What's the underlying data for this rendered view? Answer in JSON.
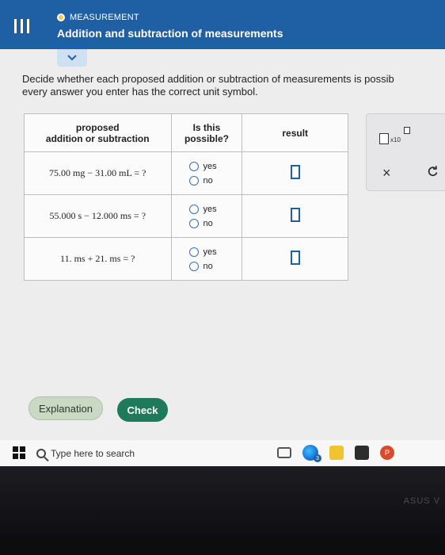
{
  "header": {
    "kicker": "MEASUREMENT",
    "title": "Addition and subtraction of measurements"
  },
  "instructions": {
    "line1": "Decide whether each proposed addition or subtraction of measurements is possib",
    "line2": "every answer you enter has the correct unit symbol."
  },
  "table": {
    "headers": {
      "col1_line1": "proposed",
      "col1_line2": "addition or subtraction",
      "col2_line1": "Is this",
      "col2_line2": "possible?",
      "col3": "result"
    },
    "rows": [
      {
        "expression": "75.00 mg − 31.00 mL = ?",
        "yes": "yes",
        "no": "no"
      },
      {
        "expression": "55.000 s − 12.000 ms = ?",
        "yes": "yes",
        "no": "no"
      },
      {
        "expression": "11. ms + 21. ms = ?",
        "yes": "yes",
        "no": "no"
      }
    ]
  },
  "tools": {
    "x10_label": "x10",
    "clear_symbol": "×"
  },
  "buttons": {
    "explanation": "Explanation",
    "check": "Check"
  },
  "taskbar": {
    "search_placeholder": "Type here to search",
    "edge_badge": "3",
    "office_letter": "P"
  },
  "device": {
    "brand": "ASUS V"
  },
  "colors": {
    "header_blue": "#1f5fa3",
    "check_green": "#1f7a5c",
    "explanation_green": "#c9d9c4"
  }
}
